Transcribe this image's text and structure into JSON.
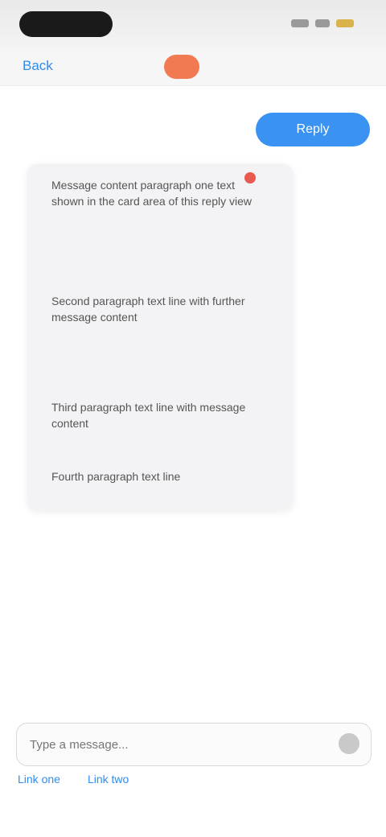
{
  "nav": {
    "back_label": "Back"
  },
  "reply_button": {
    "label": "Reply"
  },
  "card": {
    "paragraphs": [
      "Message content paragraph one text shown in the card area of this reply view",
      "Second paragraph text line with further message content",
      "Third paragraph text line with message content",
      "Fourth paragraph text line"
    ]
  },
  "composer": {
    "placeholder": "Type a message..."
  },
  "bottom_links": [
    "Link one",
    "Link two"
  ],
  "colors": {
    "accent": "#3a93f3",
    "badge": "#f27a52",
    "card_bg": "#f3f3f5",
    "status_dot": "#e85a4f"
  },
  "icons": {
    "send": "send-icon",
    "signal": "signal-icon",
    "wifi": "wifi-icon",
    "battery": "battery-icon"
  }
}
